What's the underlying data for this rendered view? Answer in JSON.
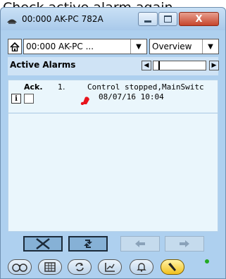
{
  "caption": "Check active alarm again",
  "window": {
    "title": "00:000 AK-PC 782A",
    "close_label": "X"
  },
  "nav": {
    "host_combo_value": "00:000 AK-PC ...",
    "view_combo_value": "Overview"
  },
  "alarms": {
    "header_title": "Active Alarms",
    "scroll_position": 0.1,
    "items": [
      {
        "ack_label": "Ack.",
        "number": "1.",
        "message": "Control stopped,MainSwitc",
        "timestamp": "08/07/16 10:04",
        "info_label": "i",
        "icon": "bell-icon"
      }
    ]
  },
  "toolbar": {
    "buttons": [
      {
        "name": "acknowledge-button",
        "icon": "x-icon",
        "enabled": true
      },
      {
        "name": "refresh-button",
        "icon": "refresh-icon",
        "enabled": true
      },
      {
        "name": "prev-button",
        "icon": "arrow-left-icon",
        "enabled": false
      },
      {
        "name": "next-button",
        "icon": "arrow-right-icon",
        "enabled": false
      }
    ]
  },
  "bottom_nav": {
    "buttons": [
      "binoculars-icon",
      "grid-icon",
      "refresh-icon",
      "graph-icon",
      "bell-icon",
      "wrench-icon"
    ],
    "active": "wrench-icon",
    "status_color": "#22aa22"
  }
}
